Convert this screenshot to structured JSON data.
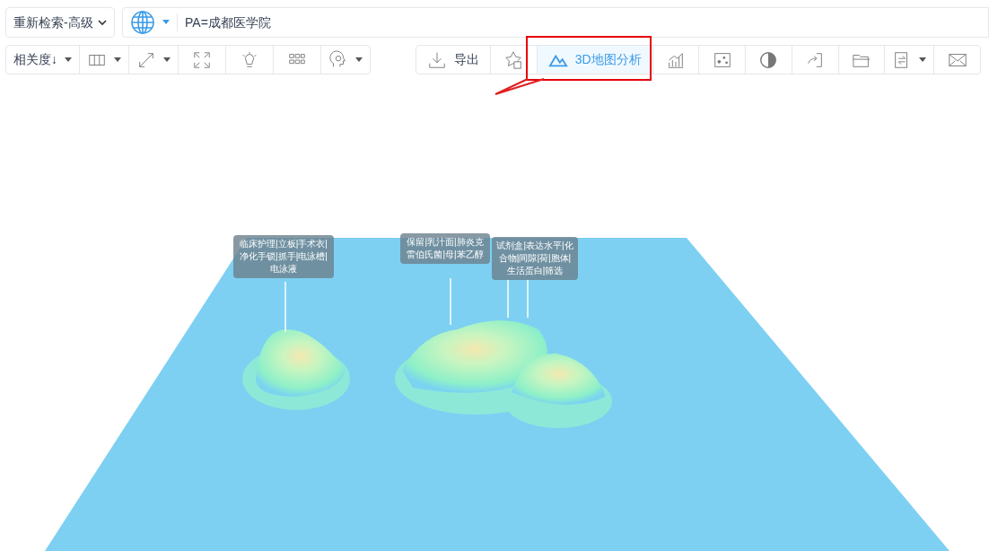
{
  "search": {
    "scope": "重新检索-高级",
    "query": "PA=成都医学院"
  },
  "toolbar_left": [
    {
      "kind": "sort",
      "label": "相关度↓"
    },
    {
      "kind": "columns"
    },
    {
      "kind": "expand"
    },
    {
      "kind": "fullscreen"
    },
    {
      "kind": "bulb"
    },
    {
      "kind": "grid"
    },
    {
      "kind": "brain"
    }
  ],
  "toolbar_right": [
    {
      "kind": "export",
      "label": "导出",
      "selected": false
    },
    {
      "kind": "star",
      "selected": false
    },
    {
      "kind": "map3d",
      "label": "3D地图分析",
      "selected": true
    },
    {
      "kind": "chart",
      "selected": false
    },
    {
      "kind": "scatter",
      "selected": false
    },
    {
      "kind": "contrast",
      "selected": false
    },
    {
      "kind": "share",
      "selected": false
    },
    {
      "kind": "folder",
      "selected": false
    },
    {
      "kind": "transfer",
      "selected": false
    },
    {
      "kind": "mail",
      "selected": false
    }
  ],
  "map_labels": [
    "临床护理|立板|手术衣|净化手锁|抓手|电泳槽|电泳液",
    "保留|乳汁面|肺炎克雷伯氏菌|母|苯乙醇",
    "试剂盒|表达水平|化合物|间隙|荷|胞体|生活蛋白|筛选"
  ]
}
